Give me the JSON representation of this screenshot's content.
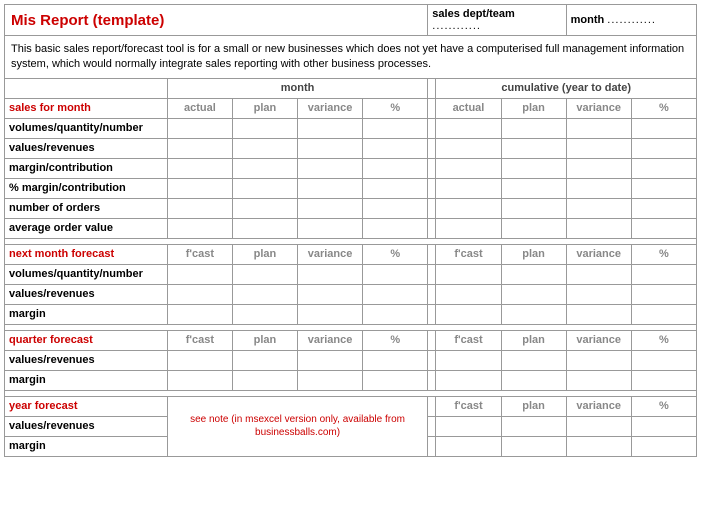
{
  "header": {
    "title": "Mis Report (template)",
    "dept_label": "sales dept/team",
    "dept_value": "............",
    "month_label": "month",
    "month_value": "............"
  },
  "description": "This basic sales report/forecast tool is for a small or new businesses which does not yet have a computerised full management information system, which would normally integrate sales reporting with other business processes.",
  "group_headers": {
    "month": "month",
    "cumulative": "cumulative (year to date)"
  },
  "cols": {
    "actual": "actual",
    "fcast": "f'cast",
    "plan": "plan",
    "variance": "variance",
    "pct": "%"
  },
  "sections": {
    "sales": {
      "title": "sales for month",
      "rows": [
        "volumes/quantity/number",
        "values/revenues",
        "margin/contribution",
        "% margin/contribution",
        "number of orders",
        "average order value"
      ]
    },
    "next": {
      "title": "next month forecast",
      "rows": [
        "volumes/quantity/number",
        "values/revenues",
        "margin"
      ]
    },
    "quarter": {
      "title": "quarter forecast",
      "rows": [
        "values/revenues",
        "margin"
      ]
    },
    "year": {
      "title": "year forecast",
      "rows": [
        "values/revenues",
        "margin"
      ],
      "note": "see note (in msexcel version only, available from businessballs.com)"
    }
  }
}
